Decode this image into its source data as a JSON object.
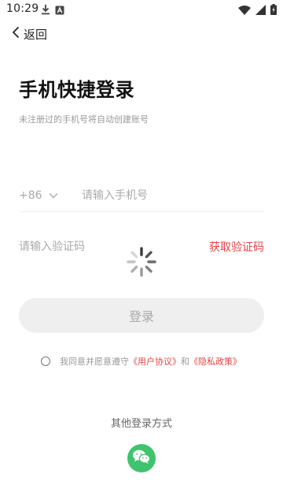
{
  "status_bar": {
    "time": "10:29",
    "left_icons": [
      "download-icon",
      "notification-a-icon"
    ],
    "right_icons": [
      "wifi-icon",
      "cell-signal-icon",
      "battery-icon"
    ]
  },
  "nav": {
    "back_label": "返回"
  },
  "login": {
    "title": "手机快捷登录",
    "subtitle": "未注册过的手机号将自动创建账号",
    "country_code": "+86",
    "phone_placeholder": "请输入手机号",
    "code_placeholder": "请输入验证码",
    "get_code_label": "获取验证码",
    "login_button": "登录"
  },
  "agreement": {
    "prefix": "我同意并愿意遵守",
    "user_agreement": "《用户协议》",
    "conjunction": "和",
    "privacy_policy": "《隐私政策》"
  },
  "other_login": {
    "label": "其他登录方式",
    "methods": [
      "wechat-icon"
    ]
  },
  "colors": {
    "accent_red": "#e84343",
    "wechat_green": "#3dc46d",
    "button_disabled_bg": "#efefef"
  }
}
